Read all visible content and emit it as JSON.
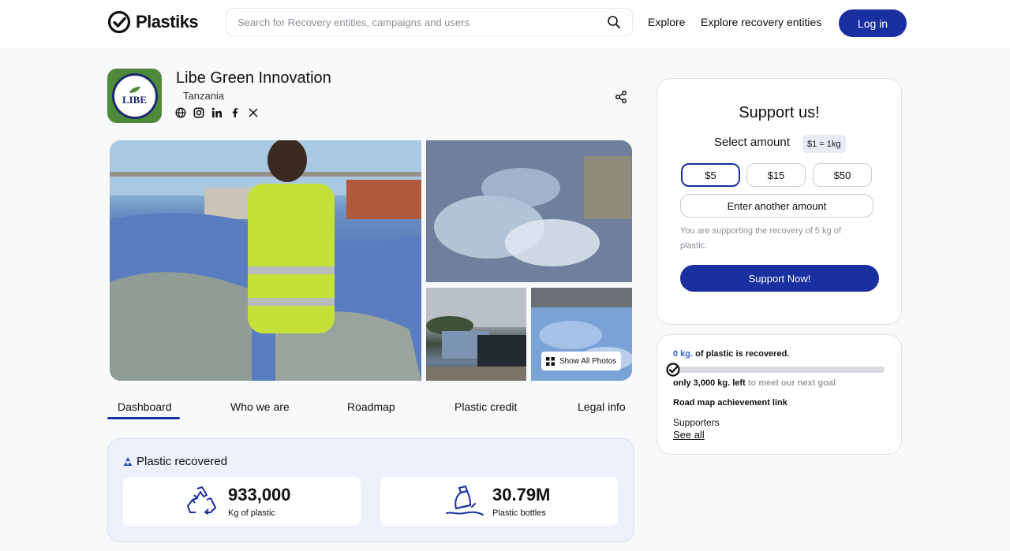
{
  "header": {
    "logo_text": "Plastiks",
    "search_placeholder": "Search for Recovery entities, campaigns and users",
    "nav": [
      "Explore",
      "Explore recovery entities"
    ],
    "login_label": "Log in"
  },
  "entity": {
    "name": "Libe Green Innovation",
    "country": "Tanzania",
    "logo_text": "LIBE",
    "socials": [
      "globe-icon",
      "instagram-icon",
      "linkedin-icon",
      "facebook-icon",
      "x-icon"
    ]
  },
  "gallery": {
    "show_all_label": "Show All Photos"
  },
  "tabs": [
    "Dashboard",
    "Who we are",
    "Roadmap",
    "Plastic credit",
    "Legal info"
  ],
  "active_tab": "Dashboard",
  "plastic_recovered": {
    "title": "Plastic recovered",
    "stats": [
      {
        "value": "933,000",
        "label": "Kg of plastic",
        "icon": "recycle-icon"
      },
      {
        "value": "30.79M",
        "label": "Plastic bottles",
        "icon": "bottle-icon"
      }
    ]
  },
  "support": {
    "title": "Support us!",
    "select_amount": "Select amount",
    "rate": "$1 = 1kg",
    "amounts": [
      "$5",
      "$15",
      "$50"
    ],
    "selected_amount": "$5",
    "other_amount": "Enter another amount",
    "note": "You are supporting the recovery of 5 kg of plastic.",
    "cta": "Support Now!"
  },
  "progress": {
    "recovered_value": "0 kg.",
    "recovered_text": " of plastic is recovered.",
    "fraction": 0,
    "left_value": "only 3,000 kg. left",
    "left_text": " to meet our next goal",
    "roadmap_link": "Road map achievement link",
    "supporters_label": "Supporters",
    "see_all": "See all"
  },
  "colors": {
    "primary": "#1a2fa0",
    "accent_text": "#2f5fd6",
    "panel_bg": "#eef1fb"
  }
}
